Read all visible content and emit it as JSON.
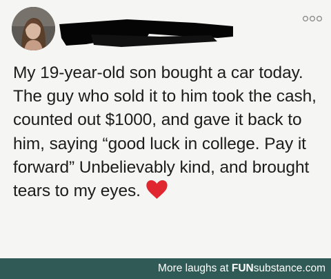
{
  "post": {
    "text": "My 19-year-old son bought a car today. The guy who sold it to him took the cash, counted out $1000, and gave it back to him, saying “good luck in college. Pay it forward” Unbelievably kind, and brought tears to my eyes.",
    "avatar_icon": "profile-photo",
    "author_name_redacted": true,
    "more_icon": "three-dots-icon",
    "reaction_icon": "red-heart-icon"
  },
  "footer": {
    "prefix": "More laughs at",
    "site_part1": "FUN",
    "site_part2": "substance",
    "site_part3": ".com"
  },
  "colors": {
    "footer_bg": "#2f5a55",
    "heart": "#e0262e",
    "text": "#1c1c1c",
    "background": "#f5f6f3"
  }
}
